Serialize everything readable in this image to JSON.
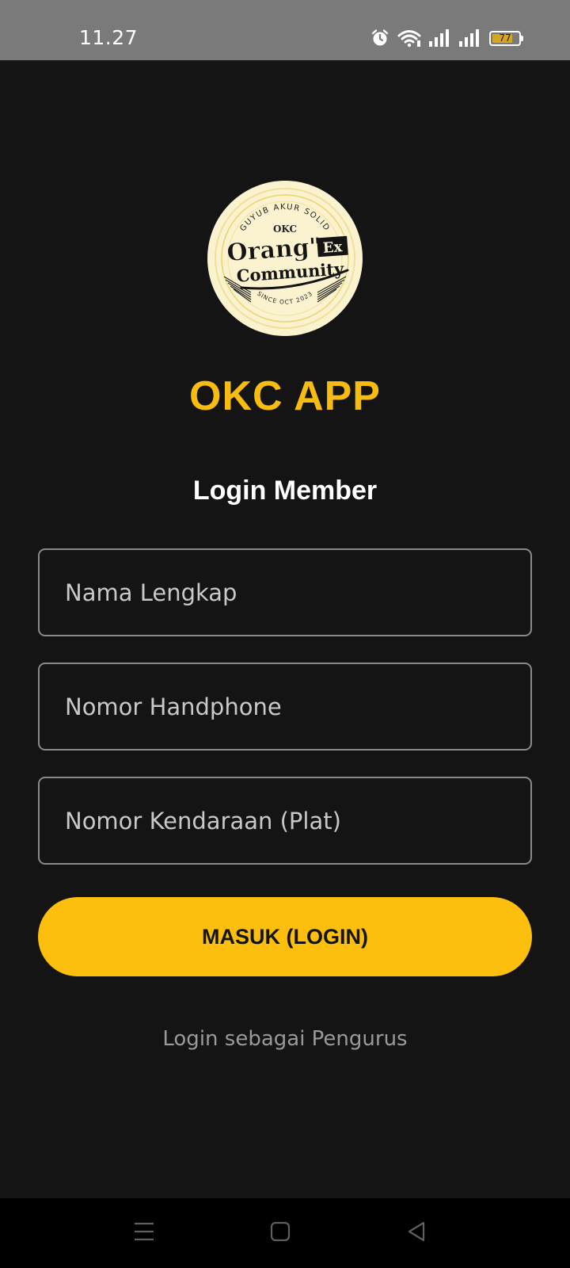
{
  "status_bar": {
    "time": "11.27",
    "icons": [
      "alarm-icon",
      "wifi-icon",
      "signal-icon",
      "signal-icon",
      "battery-icon"
    ],
    "battery_level": "77",
    "battery_fill_fraction": 0.77
  },
  "logo": {
    "top_arc": "GUYUB AKUR SOLID",
    "small_label": "OKC",
    "line1": "Orang\"",
    "line1_suffix": "Ex",
    "line2": "Community",
    "bottom_arc": "SINCE OCT 2023"
  },
  "app_title": "OKC APP",
  "login_heading": "Login Member",
  "form": {
    "name_placeholder": "Nama Lengkap",
    "phone_placeholder": "Nomor Handphone",
    "plate_placeholder": "Nomor Kendaraan (Plat)",
    "submit_label": "MASUK (LOGIN)"
  },
  "admin_link": "Login sebagai Pengurus",
  "nav_bar": {
    "icons": [
      "menu-icon",
      "home-icon",
      "back-icon"
    ]
  },
  "colors": {
    "background": "#141414",
    "accent": "#fcbf0d",
    "title": "#f7bc12",
    "status_bar": "#7a7a7a",
    "logo_bg": "#fbf3cf"
  }
}
